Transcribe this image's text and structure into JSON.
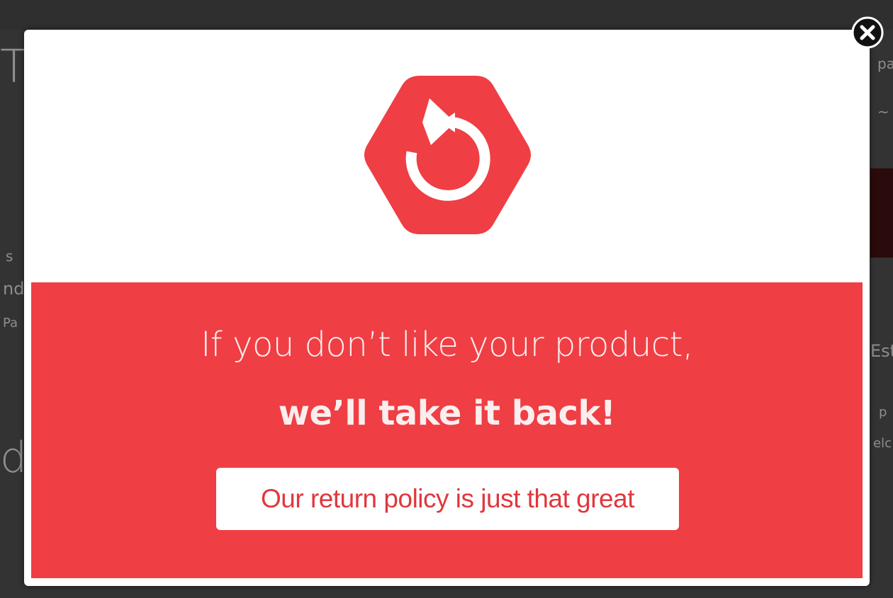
{
  "background": {
    "fragments": [
      "T/",
      "pa",
      "~",
      "s",
      "nd",
      "Pa",
      "Est",
      "p",
      "elc",
      "d"
    ]
  },
  "modal": {
    "icon": "return-arrow-icon",
    "headline": "If you don’t like your product,",
    "subline": "we’ll take it back!",
    "cta_label": "Our return policy is just that great",
    "close_icon": "close-icon"
  },
  "colors": {
    "accent": "#ef3e44",
    "cta_text": "#e0373d",
    "overlay": "#333333"
  }
}
